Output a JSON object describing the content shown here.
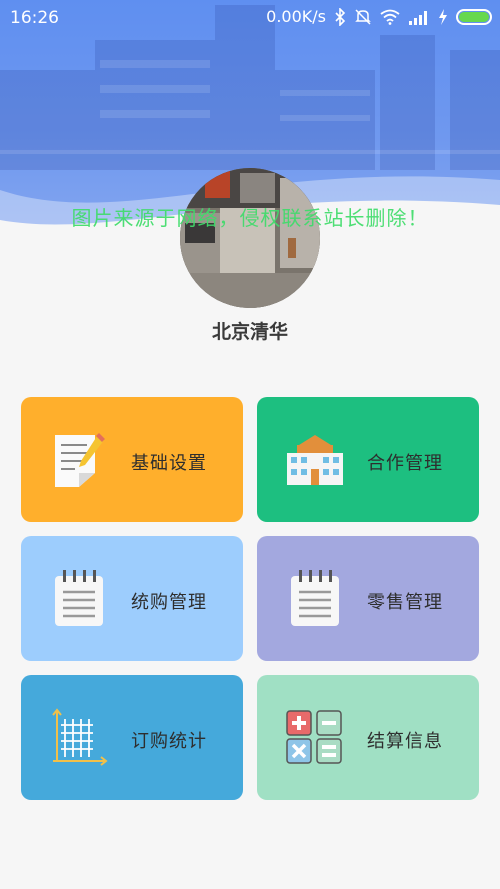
{
  "status_bar": {
    "time": "16:26",
    "net_speed": "0.00K/s",
    "icons": [
      "bluetooth-icon",
      "mute-icon",
      "wifi-icon",
      "signal-icon",
      "charging-icon",
      "battery-icon"
    ],
    "battery_color": "#67d84f"
  },
  "profile": {
    "name": "北京清华",
    "watermark": "图片来源于网络，侵权联系站长删除！"
  },
  "menu": [
    {
      "label": "基础设置",
      "color": "#ffaf2c",
      "icon": "notepad-pencil-icon"
    },
    {
      "label": "合作管理",
      "color": "#1dbf80",
      "icon": "building-icon"
    },
    {
      "label": "统购管理",
      "color": "#9dcdfd",
      "icon": "notebook-icon"
    },
    {
      "label": "零售管理",
      "color": "#a3a8df",
      "icon": "notebook-icon"
    },
    {
      "label": "订购统计",
      "color": "#45a9db",
      "icon": "grid-chart-icon"
    },
    {
      "label": "结算信息",
      "color": "#a0e0c4",
      "icon": "calculator-icon"
    }
  ],
  "colors": {
    "header": "#6f98ef",
    "watermark": "#3fdc6a"
  }
}
